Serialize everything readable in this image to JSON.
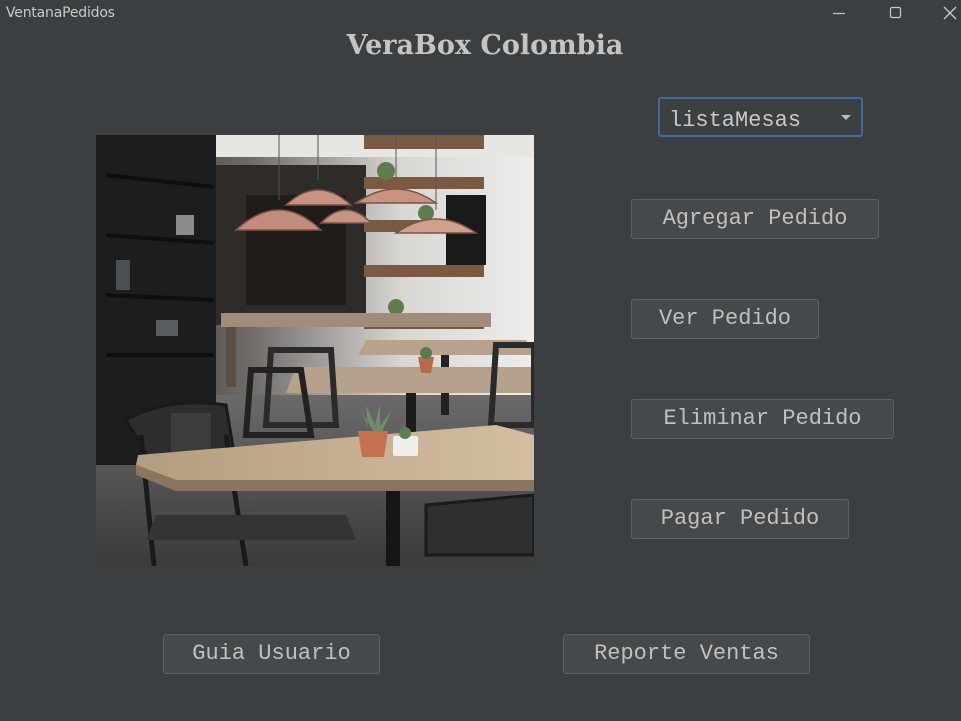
{
  "window": {
    "title": "VentanaPedidos",
    "controls": [
      "minimize-icon",
      "maximize-icon",
      "close-icon"
    ]
  },
  "header": {
    "title": "VeraBox Colombia"
  },
  "image": {
    "subject": "cafe-tables-photo"
  },
  "mesas": {
    "selected": "listaMesas"
  },
  "actions": {
    "agregar": "Agregar Pedido",
    "ver": "Ver Pedido",
    "eliminar": "Eliminar Pedido",
    "pagar": "Pagar Pedido"
  },
  "footer": {
    "guia": "Guia Usuario",
    "reporte": "Reporte Ventas"
  },
  "colors": {
    "background": "#3c3f41",
    "button": "#46494b",
    "button_border": "#5e6163",
    "focus_border": "#3f6a9a",
    "text": "#c0c0c0"
  }
}
